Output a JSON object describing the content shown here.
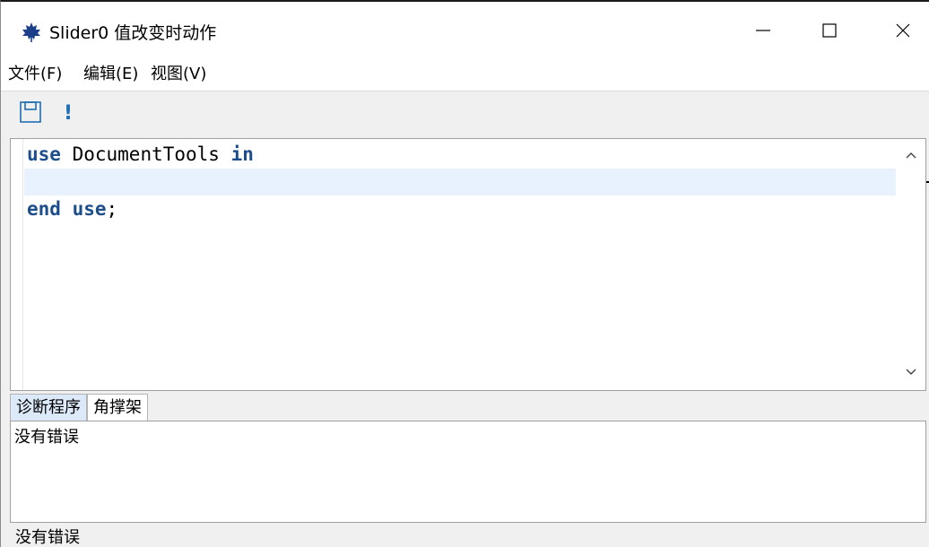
{
  "window": {
    "title": "Slider0 值改变时动作",
    "icon": "maple-leaf-icon",
    "controls": {
      "minimize": "minimize-icon",
      "maximize": "maximize-icon",
      "close": "close-icon"
    }
  },
  "menu": {
    "items": [
      {
        "label": "文件(F)"
      },
      {
        "label": "编辑(E)"
      },
      {
        "label": "视图(V)"
      }
    ]
  },
  "toolbar": {
    "buttons": [
      {
        "icon": "save-icon"
      },
      {
        "icon": "execute-icon",
        "glyph": "!"
      }
    ],
    "accent": "#1f6fb2"
  },
  "editor": {
    "lines": [
      {
        "keyword1": "use",
        "text": " DocumentTools ",
        "keyword2": "in"
      },
      {
        "text": ""
      },
      {
        "keyword1": "end",
        "text": " ",
        "keyword2": "use",
        "tail": ";"
      }
    ],
    "keyword_color": "#1c4e8c",
    "active_line_color": "#e8f2fe"
  },
  "tabs": [
    {
      "label": "诊断程序",
      "active": true
    },
    {
      "label": "角撑架",
      "active": false
    }
  ],
  "diagnostics": {
    "message": "没有错误"
  },
  "status": {
    "text": "没有错误"
  }
}
